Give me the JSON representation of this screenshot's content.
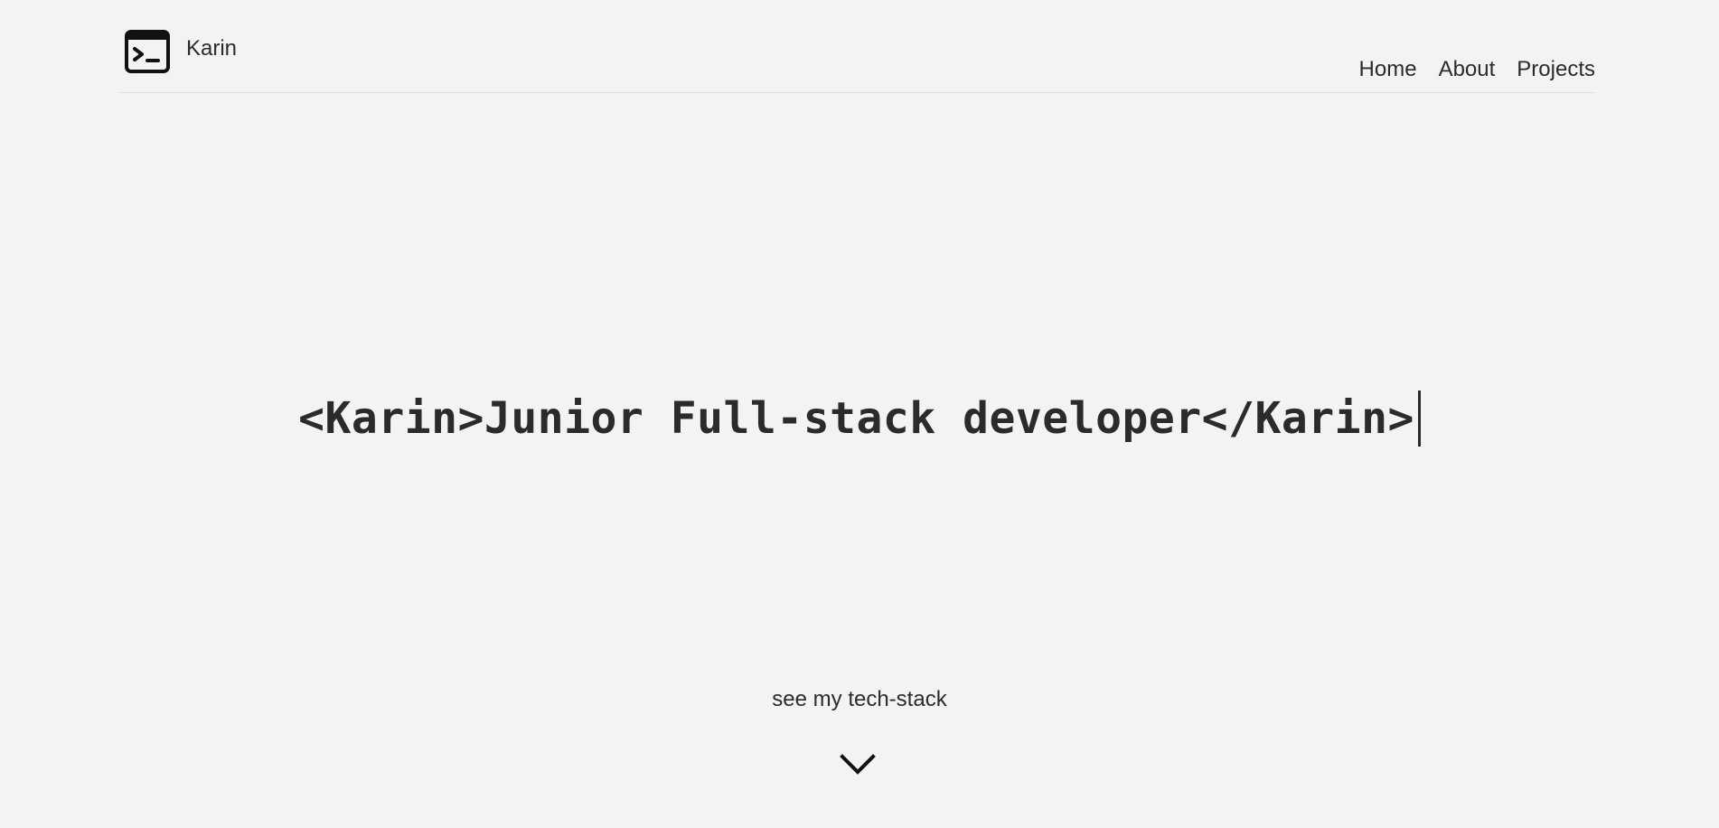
{
  "header": {
    "brand": {
      "name": "Karin",
      "icon": "terminal-icon"
    },
    "nav": [
      {
        "label": "Home"
      },
      {
        "label": "About"
      },
      {
        "label": "Projects"
      }
    ]
  },
  "hero": {
    "headline": "<Karin>Junior Full-stack developer</Karin>",
    "cursor": "text-cursor"
  },
  "cta": {
    "label": "see my tech-stack",
    "icon": "chevron-down-icon"
  },
  "colors": {
    "background": "#f3f3f3",
    "text": "#2b2b2b",
    "divider": "#dddddd"
  }
}
